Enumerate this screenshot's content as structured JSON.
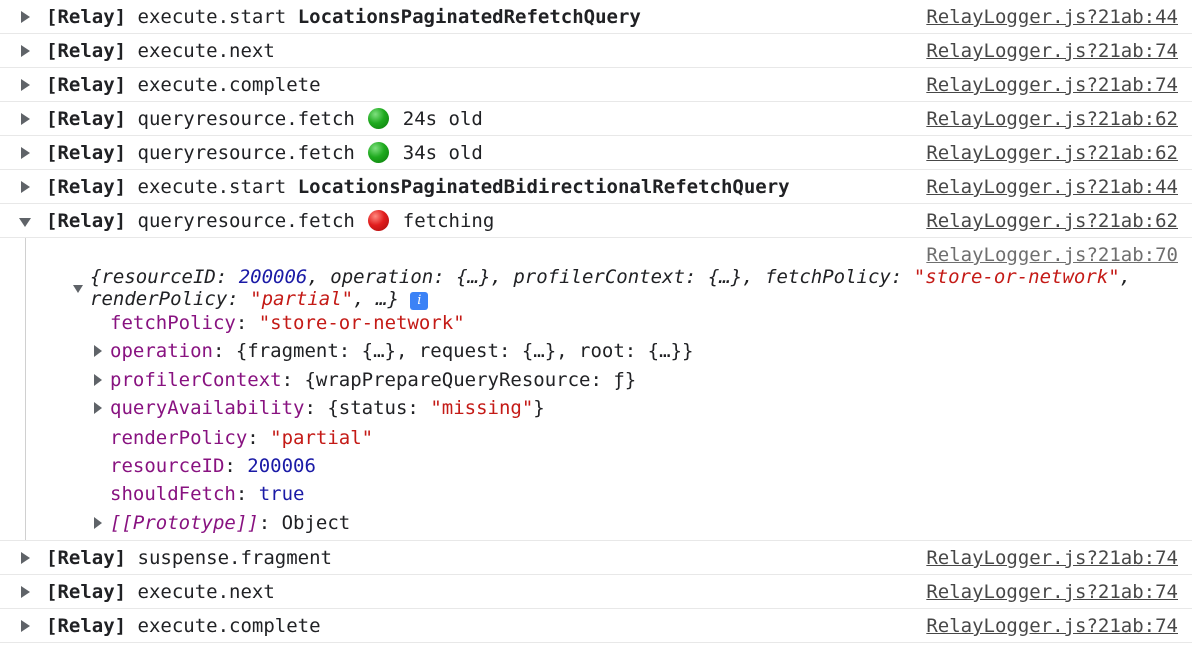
{
  "rows_top": [
    {
      "prefix": "[Relay]",
      "event": "execute.start",
      "query": "LocationsPaginatedRefetchQuery",
      "source": "RelayLogger.js?21ab:44"
    },
    {
      "prefix": "[Relay]",
      "event": "execute.next",
      "source": "RelayLogger.js?21ab:74"
    },
    {
      "prefix": "[Relay]",
      "event": "execute.complete",
      "source": "RelayLogger.js?21ab:74"
    },
    {
      "prefix": "[Relay]",
      "event": "queryresource.fetch",
      "status_icon": "green-circle",
      "status_text": "24s old",
      "source": "RelayLogger.js?21ab:62"
    },
    {
      "prefix": "[Relay]",
      "event": "queryresource.fetch",
      "status_icon": "green-circle",
      "status_text": "34s old",
      "source": "RelayLogger.js?21ab:62"
    },
    {
      "prefix": "[Relay]",
      "event": "execute.start",
      "query": "LocationsPaginatedBidirectionalRefetchQuery",
      "source": "RelayLogger.js?21ab:44"
    },
    {
      "prefix": "[Relay]",
      "event": "queryresource.fetch",
      "status_icon": "red-circle",
      "status_text": "fetching",
      "source": "RelayLogger.js?21ab:62"
    }
  ],
  "expanded": {
    "source": "RelayLogger.js?21ab:70",
    "summary": {
      "k_resourceID": "resourceID",
      "v_resourceID": "200006",
      "k_operation": "operation",
      "v_operation": "{…}",
      "k_profilerContext": "profilerContext",
      "v_profilerContext": "{…}",
      "k_fetchPolicy": "fetchPolicy",
      "v_fetchPolicy": "\"store-or-network\"",
      "k_renderPolicy": "renderPolicy",
      "v_renderPolicy": "\"partial\"",
      "ellipsis": "…",
      "info_icon": "i"
    },
    "props": {
      "fetchPolicy": {
        "key": "fetchPolicy",
        "value": "\"store-or-network\""
      },
      "operation": {
        "key": "operation",
        "value": "{fragment: {…}, request: {…}, root: {…}}"
      },
      "profilerContext": {
        "key": "profilerContext",
        "value": "{wrapPrepareQueryResource: ƒ}"
      },
      "queryAvailability": {
        "key": "queryAvailability",
        "v1": "{status: ",
        "v2": "\"missing\"",
        "v3": "}"
      },
      "renderPolicy": {
        "key": "renderPolicy",
        "value": "\"partial\""
      },
      "resourceID": {
        "key": "resourceID",
        "value": "200006"
      },
      "shouldFetch": {
        "key": "shouldFetch",
        "value": "true"
      },
      "prototype": {
        "key": "[[Prototype]]",
        "value": "Object"
      }
    }
  },
  "rows_bottom": [
    {
      "prefix": "[Relay]",
      "event": "suspense.fragment",
      "source": "RelayLogger.js?21ab:74"
    },
    {
      "prefix": "[Relay]",
      "event": "execute.next",
      "source": "RelayLogger.js?21ab:74"
    },
    {
      "prefix": "[Relay]",
      "event": "execute.complete",
      "source": "RelayLogger.js?21ab:74"
    }
  ]
}
